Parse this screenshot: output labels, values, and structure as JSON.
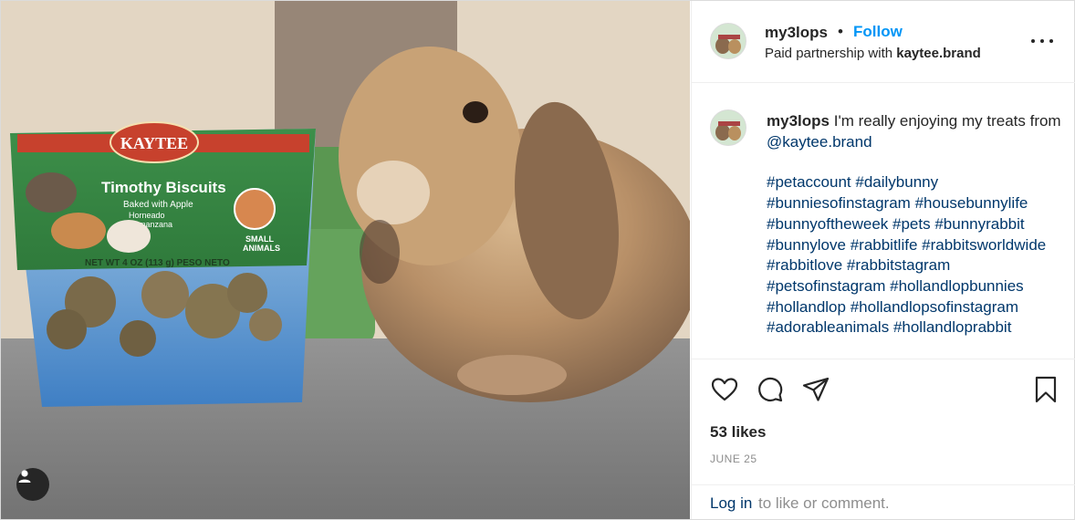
{
  "post": {
    "username": "my3lops",
    "dot": "•",
    "follow_label": "Follow",
    "partnership_prefix": "Paid partnership with",
    "partner": "kaytee.brand",
    "more_icon": "more-options-icon"
  },
  "photo": {
    "product_brand": "KAYTEE",
    "product_name": "Timothy Biscuits",
    "product_sub": "Baked with Apple",
    "product_sub_es1": "Horneado",
    "product_sub_es2": "con manzana",
    "product_small": "SMALL",
    "product_animals": "ANIMALS",
    "product_net": "NET WT 4 OZ (113 g) PESO NETO",
    "user_tag_icon": "user-tags-icon"
  },
  "caption": {
    "username": "my3lops",
    "text": "I'm really enjoying my treats from",
    "mention": "@kaytee.brand",
    "hashtags": [
      "#petaccount",
      "#dailybunny",
      "#bunniesofinstagram",
      "#housebunnylife",
      "#bunnyoftheweek",
      "#pets",
      "#bunnyrabbit",
      "#bunnylove",
      "#rabbitlife",
      "#rabbitsworldwide",
      "#rabbitlove",
      "#rabbitstagram",
      "#petsofinstagram",
      "#hollandlopbunnies",
      "#hollandlop",
      "#hollandlopsofinstagram",
      "#adorableanimals",
      "#hollandloprabbit"
    ]
  },
  "actions": {
    "icons": [
      "heart-icon",
      "comment-icon",
      "share-icon",
      "bookmark-icon"
    ],
    "likes": "53 likes",
    "date": "JUNE 25"
  },
  "footer": {
    "login_label": "Log in",
    "rest_text": "to like or comment."
  },
  "colors": {
    "link_blue": "#0095f6",
    "hashtag_blue": "#00376b",
    "muted_gray": "#8e8e8e"
  }
}
